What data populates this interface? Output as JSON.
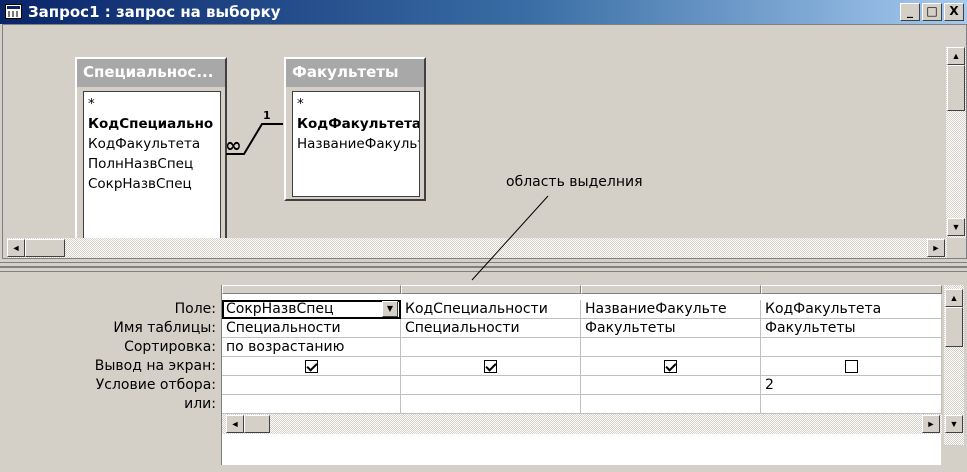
{
  "window": {
    "title": "Запрос1 : запрос на выборку",
    "minimize": "_",
    "maximize": "□",
    "close": "X"
  },
  "tables": [
    {
      "header": "Специальнос...",
      "fields": [
        "*",
        "КодСпециально",
        "КодФакультета",
        "ПолнНазвСпец",
        "СокрНазвСпец"
      ],
      "key_index": 1
    },
    {
      "header": "Факультеты",
      "fields": [
        "*",
        "КодФакультета",
        "НазваниеФакульт"
      ],
      "key_index": 1
    }
  ],
  "relation": {
    "many": "∞",
    "one": "1"
  },
  "callout": "область выделния",
  "row_labels": [
    "Поле:",
    "Имя таблицы:",
    "Сортировка:",
    "Вывод на экран:",
    "Условие отбора:",
    "или:"
  ],
  "columns": [
    {
      "field": "СокрНазвСпец",
      "table": "Специальности",
      "sort": "по возрастанию",
      "show": true,
      "criteria": "",
      "or": ""
    },
    {
      "field": "КодСпециальности",
      "table": "Специальности",
      "sort": "",
      "show": true,
      "criteria": "",
      "or": ""
    },
    {
      "field": "НазваниеФакульте",
      "table": "Факультеты",
      "sort": "",
      "show": true,
      "criteria": "",
      "or": ""
    },
    {
      "field": "КодФакультета",
      "table": "Факультеты",
      "sort": "",
      "show": false,
      "criteria": "2",
      "or": ""
    }
  ],
  "icons": {
    "title": "query-window-icon",
    "scroll_up": "▲",
    "scroll_down": "▼",
    "scroll_left": "◄",
    "scroll_right": "►",
    "dropdown": "▼"
  },
  "colors": {
    "titlebar_start": "#0a246a",
    "titlebar_end": "#a6caf0",
    "table_header": "#a8a8a8",
    "face": "#d4d0c8"
  }
}
